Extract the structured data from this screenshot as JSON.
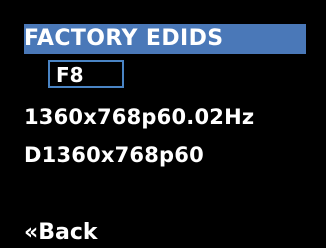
{
  "header": {
    "title": "FACTORY EDIDS"
  },
  "selection": {
    "code": "F8"
  },
  "details": {
    "timing": "1360x768p60.02Hz",
    "descriptor": "D1360x768p60"
  },
  "footer": {
    "back_label": "«Back"
  },
  "colors": {
    "background": "#000000",
    "title_bar": "#4a78b8",
    "selection_border": "#4a84c4",
    "text": "#ffffff"
  }
}
